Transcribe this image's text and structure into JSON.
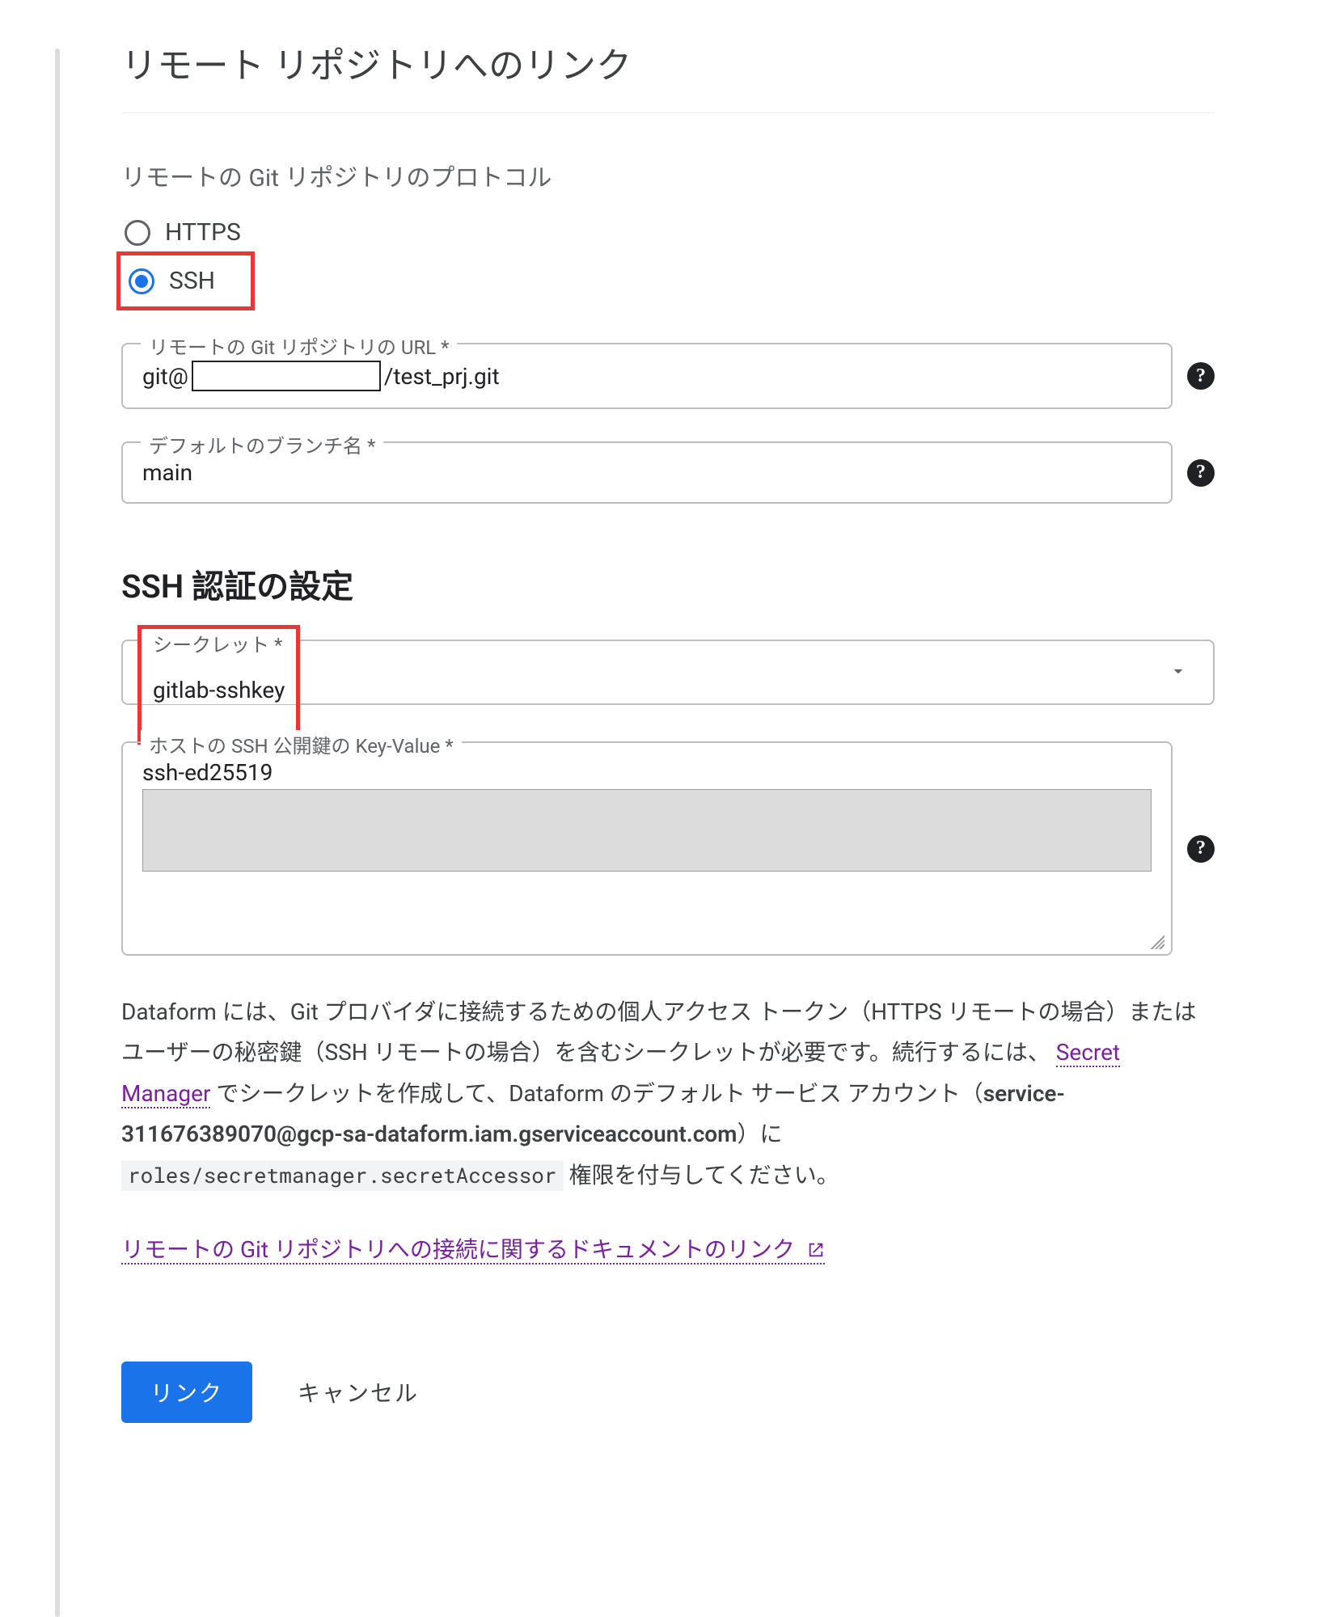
{
  "title": "リモート リポジトリへのリンク",
  "protocol": {
    "label": "リモートの Git リポジトリのプロトコル",
    "options": {
      "https": "HTTPS",
      "ssh": "SSH"
    },
    "selected": "ssh"
  },
  "url_field": {
    "label": "リモートの Git リポジトリの URL *",
    "value_prefix": "git@",
    "value_suffix": "/test_prj.git"
  },
  "branch_field": {
    "label": "デフォルトのブランチ名 *",
    "value": "main"
  },
  "ssh_section_title": "SSH 認証の設定",
  "secret_field": {
    "label": "シークレット *",
    "value": "gitlab-sshkey"
  },
  "hostkey_field": {
    "label": "ホストの SSH 公開鍵の Key-Value *",
    "prefix_line": "ssh-ed25519"
  },
  "info": {
    "part1": "Dataform には、Git プロバイダに接続するための個人アクセス トークン（HTTPS リモートの場合）またはユーザーの秘密鍵（SSH リモートの場合）を含むシークレットが必要です。続行するには、",
    "secret_manager_link": "Secret Manager",
    "part2": " でシークレットを作成して、Dataform のデフォルト サービス アカウント（",
    "service_account": "service-311676389070@gcp-sa-dataform.iam.gserviceaccount.com",
    "part3": "）に ",
    "role_code": "roles/secretmanager.secretAccessor",
    "part4": " 権限を付与してください。"
  },
  "doc_link_text": "リモートの Git リポジトリへの接続に関するドキュメントのリンク",
  "actions": {
    "primary": "リンク",
    "cancel": "キャンセル"
  }
}
